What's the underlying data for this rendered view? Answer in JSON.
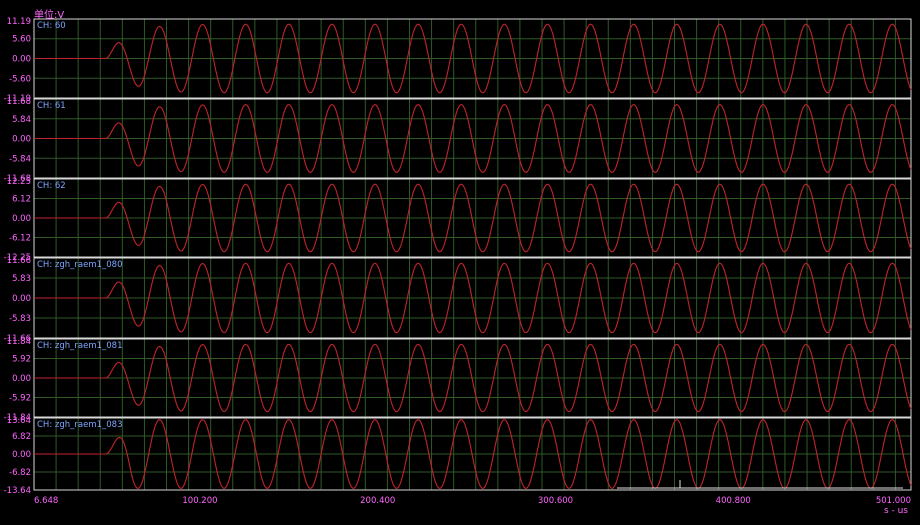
{
  "unit_label": "单位:V",
  "x_unit_label": "s - us",
  "colors": {
    "background": "#000000",
    "panel_border": "#d8d8d8",
    "grid": "#2e5a26",
    "trace": "#c0242c",
    "tick_text": "#ff66ff",
    "channel_text": "#7ea6ff"
  },
  "chart_data": {
    "type": "line",
    "x_axis": {
      "min": 6.648,
      "max": 501.0,
      "ticks": [
        "6.648",
        "100.200",
        "200.400",
        "300.600",
        "400.800",
        "501.000"
      ],
      "tick_values": [
        6.648,
        100.2,
        200.4,
        300.6,
        400.8,
        501.0
      ],
      "label": "s - us"
    },
    "signal": {
      "onset_x": 47.0,
      "period_us": 24.3,
      "description_free_values": true
    },
    "series": [
      {
        "name": "CH: 60",
        "ymin": -11.19,
        "ymax": 11.19,
        "ticks": [
          "11.19",
          "5.60",
          "0.00",
          "-5.60",
          "-11.19"
        ],
        "amplitude": 9.7
      },
      {
        "name": "CH: 61",
        "ymin": -11.68,
        "ymax": 11.68,
        "ticks": [
          "11.68",
          "5.84",
          "0.00",
          "-5.84",
          "-11.68"
        ],
        "amplitude": 10.0
      },
      {
        "name": "CH: 62",
        "ymin": -12.25,
        "ymax": 12.25,
        "ticks": [
          "12.25",
          "6.12",
          "0.00",
          "-6.12",
          "-12.25"
        ],
        "amplitude": 10.6
      },
      {
        "name": "CH: zgh_raem1_080",
        "ymin": -11.66,
        "ymax": 11.66,
        "ticks": [
          "11.66",
          "5.83",
          "0.00",
          "-5.83",
          "-11.66"
        ],
        "amplitude": 10.1
      },
      {
        "name": "CH: zgh_raem1_081",
        "ymin": -11.84,
        "ymax": 11.84,
        "ticks": [
          "11.84",
          "5.92",
          "0.00",
          "-5.92",
          "-11.84"
        ],
        "amplitude": 10.2
      },
      {
        "name": "CH: zgh_raem1_083",
        "ymin": -13.64,
        "ymax": 13.64,
        "ticks": [
          "13.64",
          "6.82",
          "0.00",
          "-6.82",
          "-13.64"
        ],
        "amplitude": 13.0
      }
    ]
  }
}
